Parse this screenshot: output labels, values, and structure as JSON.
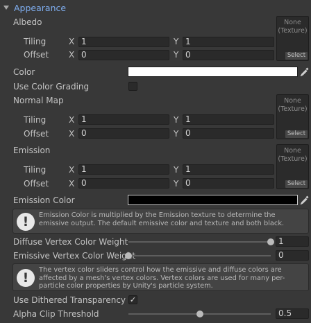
{
  "section": {
    "title": "Appearance"
  },
  "texture_slot": {
    "line1": "None",
    "line2": "(Texture)",
    "select_label": "Select"
  },
  "albedo": {
    "label": "Albedo",
    "tiling_label": "Tiling",
    "offset_label": "Offset",
    "tiling_x": "1",
    "tiling_y": "1",
    "offset_x": "0",
    "offset_y": "0"
  },
  "axis": {
    "x": "X",
    "y": "Y"
  },
  "color": {
    "label": "Color",
    "value": "#ffffff"
  },
  "use_color_grading": {
    "label": "Use Color Grading",
    "checked": false
  },
  "normal_map": {
    "label": "Normal Map",
    "tiling_label": "Tiling",
    "offset_label": "Offset",
    "tiling_x": "1",
    "tiling_y": "1",
    "offset_x": "0",
    "offset_y": "0"
  },
  "emission": {
    "label": "Emission",
    "tiling_label": "Tiling",
    "offset_label": "Offset",
    "tiling_x": "1",
    "tiling_y": "1",
    "offset_x": "0",
    "offset_y": "0"
  },
  "emission_color": {
    "label": "Emission Color",
    "value": "#000000"
  },
  "help_emission": "Emission Color is multiplied by the Emission texture to determine the emissive output. The default emissive color and texture and both black.",
  "diffuse_weight": {
    "label": "Diffuse Vertex Color Weight",
    "value": "1",
    "fraction": 1.0
  },
  "emissive_weight": {
    "label": "Emissive Vertex Color Weight",
    "value": "0",
    "fraction": 0.0
  },
  "help_vertex": "The vertex color sliders control how the emissive and diffuse colors are affected by a mesh's vertex colors. Vertex colors are used for many per-particle color properties by Unity's particle system.",
  "dithered": {
    "label": "Use Dithered Transparency",
    "checked": true
  },
  "alpha_clip": {
    "label": "Alpha Clip Threshold",
    "value": "0.5",
    "fraction": 0.5
  },
  "icons": {
    "foldout": "triangle-down",
    "picker": "eyedropper",
    "warning": "exclamation-circle"
  }
}
